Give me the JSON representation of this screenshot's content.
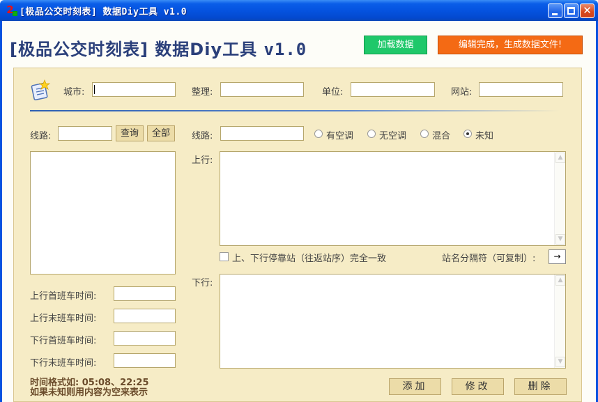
{
  "window": {
    "title": "[极品公交时刻表] 数据Diy工具 v1.0",
    "app_icon": "2-app-icon"
  },
  "header": {
    "title": "[极品公交时刻表] 数据Diy工具",
    "version": "v1.0",
    "load_button": "加载数据",
    "generate_button": "编辑完成，生成数据文件!",
    "load_color": "#1fc86a",
    "generate_color": "#f46a14"
  },
  "meta": {
    "city_label": "城市:",
    "city_value": "",
    "editor_label": "整理:",
    "editor_value": "",
    "unit_label": "单位:",
    "unit_value": "",
    "website_label": "网站:",
    "website_value": ""
  },
  "left": {
    "route_label": "线路:",
    "route_value": "",
    "query_button": "查询",
    "all_button": "全部",
    "up_first_label": "上行首班车时间:",
    "up_last_label": "上行末班车时间:",
    "down_first_label": "下行首班车时间:",
    "down_last_label": "下行末班车时间:",
    "time_note": "时间格式如: 05:08、22:25",
    "empty_note": "如果未知则用内容为空来表示"
  },
  "right": {
    "route_label": "线路:",
    "route_value": "",
    "aircon_options": [
      "有空调",
      "无空调",
      "混合",
      "未知"
    ],
    "aircon_selected": "未知",
    "up_label": "上行:",
    "same_stops_label": "上、下行停靠站（往返站序）完全一致",
    "same_stops_checked": false,
    "separator_label": "站名分隔符（可复制）:",
    "separator_value": "→",
    "down_label": "下行:"
  },
  "actions": {
    "add": "添加",
    "edit": "修改",
    "delete": "删除"
  }
}
